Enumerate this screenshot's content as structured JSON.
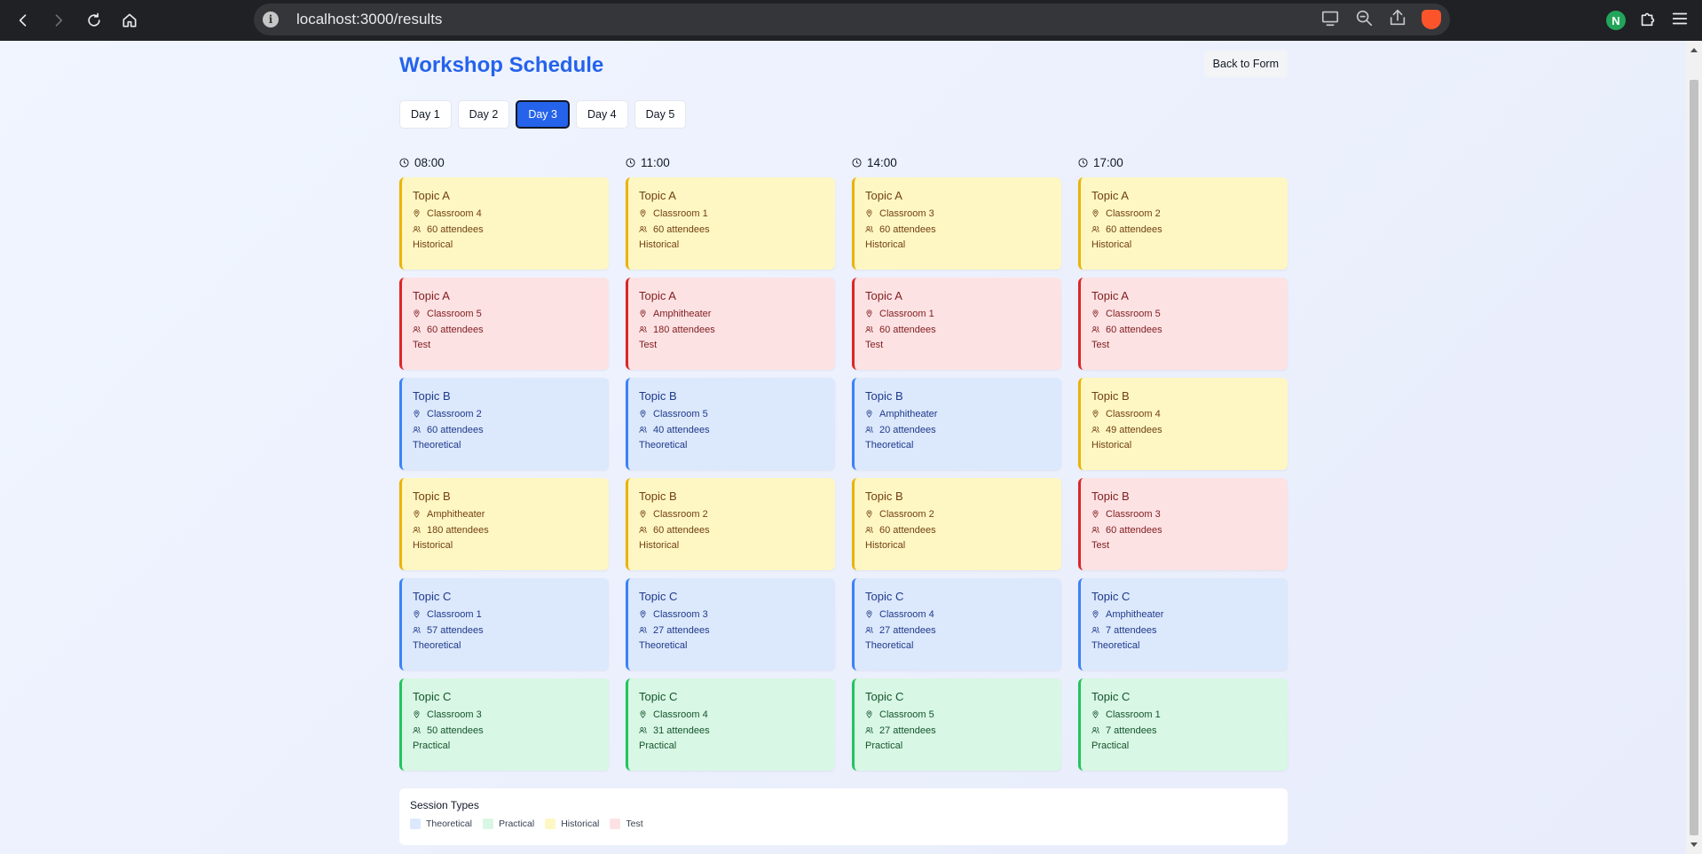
{
  "browser": {
    "url": "localhost:3000/results"
  },
  "page": {
    "title": "Workshop Schedule",
    "back_label": "Back to Form"
  },
  "tabs": [
    {
      "label": "Day 1",
      "active": false
    },
    {
      "label": "Day 2",
      "active": false
    },
    {
      "label": "Day 3",
      "active": true
    },
    {
      "label": "Day 4",
      "active": false
    },
    {
      "label": "Day 5",
      "active": false
    }
  ],
  "columns": [
    {
      "time": "08:00",
      "sessions": [
        {
          "topic": "Topic A",
          "room": "Classroom 4",
          "attendees": "60 attendees",
          "type": "Historical"
        },
        {
          "topic": "Topic A",
          "room": "Classroom 5",
          "attendees": "60 attendees",
          "type": "Test"
        },
        {
          "topic": "Topic B",
          "room": "Classroom 2",
          "attendees": "60 attendees",
          "type": "Theoretical"
        },
        {
          "topic": "Topic B",
          "room": "Amphitheater",
          "attendees": "180 attendees",
          "type": "Historical"
        },
        {
          "topic": "Topic C",
          "room": "Classroom 1",
          "attendees": "57 attendees",
          "type": "Theoretical"
        },
        {
          "topic": "Topic C",
          "room": "Classroom 3",
          "attendees": "50 attendees",
          "type": "Practical"
        }
      ]
    },
    {
      "time": "11:00",
      "sessions": [
        {
          "topic": "Topic A",
          "room": "Classroom 1",
          "attendees": "60 attendees",
          "type": "Historical"
        },
        {
          "topic": "Topic A",
          "room": "Amphitheater",
          "attendees": "180 attendees",
          "type": "Test"
        },
        {
          "topic": "Topic B",
          "room": "Classroom 5",
          "attendees": "40 attendees",
          "type": "Theoretical"
        },
        {
          "topic": "Topic B",
          "room": "Classroom 2",
          "attendees": "60 attendees",
          "type": "Historical"
        },
        {
          "topic": "Topic C",
          "room": "Classroom 3",
          "attendees": "27 attendees",
          "type": "Theoretical"
        },
        {
          "topic": "Topic C",
          "room": "Classroom 4",
          "attendees": "31 attendees",
          "type": "Practical"
        }
      ]
    },
    {
      "time": "14:00",
      "sessions": [
        {
          "topic": "Topic A",
          "room": "Classroom 3",
          "attendees": "60 attendees",
          "type": "Historical"
        },
        {
          "topic": "Topic A",
          "room": "Classroom 1",
          "attendees": "60 attendees",
          "type": "Test"
        },
        {
          "topic": "Topic B",
          "room": "Amphitheater",
          "attendees": "20 attendees",
          "type": "Theoretical"
        },
        {
          "topic": "Topic B",
          "room": "Classroom 2",
          "attendees": "60 attendees",
          "type": "Historical"
        },
        {
          "topic": "Topic C",
          "room": "Classroom 4",
          "attendees": "27 attendees",
          "type": "Theoretical"
        },
        {
          "topic": "Topic C",
          "room": "Classroom 5",
          "attendees": "27 attendees",
          "type": "Practical"
        }
      ]
    },
    {
      "time": "17:00",
      "sessions": [
        {
          "topic": "Topic A",
          "room": "Classroom 2",
          "attendees": "60 attendees",
          "type": "Historical"
        },
        {
          "topic": "Topic A",
          "room": "Classroom 5",
          "attendees": "60 attendees",
          "type": "Test"
        },
        {
          "topic": "Topic B",
          "room": "Classroom 4",
          "attendees": "49 attendees",
          "type": "Historical"
        },
        {
          "topic": "Topic B",
          "room": "Classroom 3",
          "attendees": "60 attendees",
          "type": "Test"
        },
        {
          "topic": "Topic C",
          "room": "Amphitheater",
          "attendees": "7 attendees",
          "type": "Theoretical"
        },
        {
          "topic": "Topic C",
          "room": "Classroom 1",
          "attendees": "7 attendees",
          "type": "Practical"
        }
      ]
    }
  ],
  "legend": {
    "title": "Session Types",
    "items": [
      {
        "label": "Theoretical",
        "color": "#dce8fc"
      },
      {
        "label": "Practical",
        "color": "#d8f7e4"
      },
      {
        "label": "Historical",
        "color": "#fef7c3"
      },
      {
        "label": "Test",
        "color": "#fde2e4"
      }
    ]
  }
}
